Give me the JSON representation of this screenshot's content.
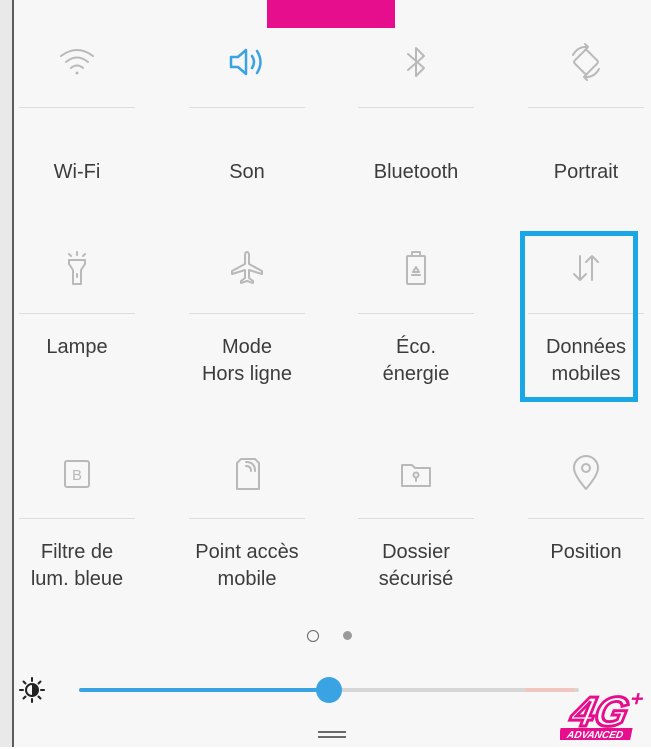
{
  "tiles": [
    {
      "label": "Wi-Fi",
      "icon": "wifi-icon"
    },
    {
      "label": "Son",
      "icon": "speaker-icon",
      "active": true
    },
    {
      "label": "Bluetooth",
      "icon": "bluetooth-icon"
    },
    {
      "label": "Portrait",
      "icon": "rotate-icon"
    },
    {
      "label": "Lampe",
      "icon": "flashlight-icon"
    },
    {
      "label": "Mode\nHors ligne",
      "icon": "airplane-icon"
    },
    {
      "label": "Éco.\nénergie",
      "icon": "battery-saver-icon"
    },
    {
      "label": "Données\nmobiles",
      "icon": "mobile-data-icon",
      "highlighted": true
    },
    {
      "label": "Filtre de\nlum. bleue",
      "icon": "blue-light-filter-icon"
    },
    {
      "label": "Point accès\nmobile",
      "icon": "hotspot-icon"
    },
    {
      "label": "Dossier\nsécurisé",
      "icon": "secure-folder-icon"
    },
    {
      "label": "Position",
      "icon": "location-icon"
    }
  ],
  "pagination": {
    "current": 1,
    "total": 2
  },
  "brightness": {
    "icon": "brightness-icon",
    "level": 0.5
  },
  "colors": {
    "accent": "#3aa3e3",
    "highlight": "#1aa7e6",
    "brand_pink": "#e60e8c",
    "text": "#3c3c3c"
  },
  "logo": {
    "main": "4G",
    "plus": "+",
    "sub": "ADVANCED"
  }
}
